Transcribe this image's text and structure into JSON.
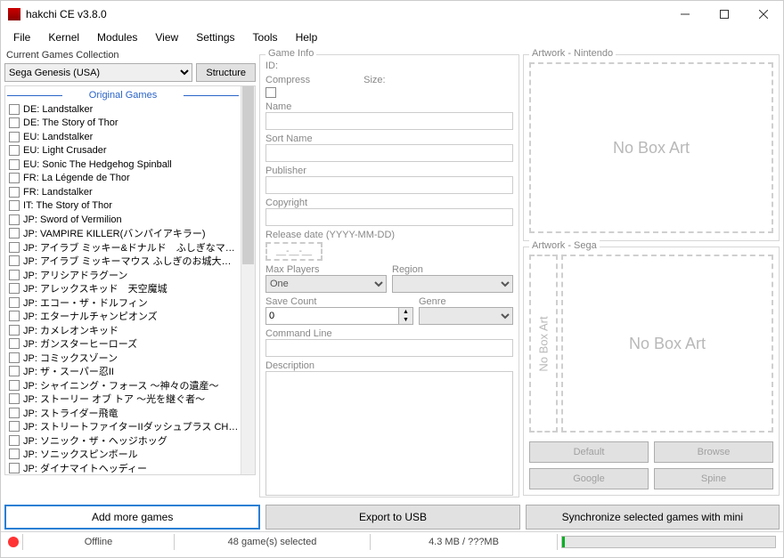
{
  "window": {
    "title": "hakchi CE v3.8.0"
  },
  "menu": [
    "File",
    "Kernel",
    "Modules",
    "View",
    "Settings",
    "Tools",
    "Help"
  ],
  "collection": {
    "label": "Current Games Collection",
    "selected": "Sega Genesis (USA)",
    "structure_btn": "Structure"
  },
  "games": {
    "header": "Original Games",
    "items": [
      "DE: Landstalker",
      "DE: The Story of Thor",
      "EU: Landstalker",
      "EU: Light Crusader",
      "EU: Sonic The Hedgehog Spinball",
      "FR: La Légende de Thor",
      "FR: Landstalker",
      "IT: The Story of Thor",
      "JP: Sword of Vermilion",
      "JP: VAMPIRE KILLER(バンパイアキラー)",
      "JP: アイラブ ミッキー&ドナルド　ふしぎなマジックボッ...",
      "JP: アイラブ ミッキーマウス ふしぎのお城大冒険",
      "JP: アリシアドラグーン",
      "JP: アレックスキッド　天空魔城",
      "JP: エコー・ザ・ドルフィン",
      "JP: エターナルチャンピオンズ",
      "JP: カメレオンキッド",
      "JP: ガンスターヒーローズ",
      "JP: コミックスゾーン",
      "JP: ザ・スーパー忍II",
      "JP: シャイニング・フォース ～神々の遺産～",
      "JP: ストーリー オブ トア ～光を継ぐ者～",
      "JP: ストライダー飛竜",
      "JP: ストリートファイターIIダッシュプラス CHAMPION E...",
      "JP: ソニック・ザ・ヘッジホッグ",
      "JP: ソニックスピンボール",
      "JP: ダイナマイトヘッディー"
    ]
  },
  "info": {
    "group": "Game Info",
    "id_lbl": "ID:",
    "compress_lbl": "Compress",
    "size_lbl": "Size:",
    "name_lbl": "Name",
    "sort_lbl": "Sort Name",
    "publisher_lbl": "Publisher",
    "copyright_lbl": "Copyright",
    "release_lbl": "Release date (YYYY-MM-DD)",
    "release_val": "__-__-__",
    "maxp_lbl": "Max Players",
    "maxp_val": "One",
    "region_lbl": "Region",
    "save_lbl": "Save Count",
    "save_val": "0",
    "genre_lbl": "Genre",
    "cmd_lbl": "Command Line",
    "desc_lbl": "Description"
  },
  "art": {
    "nin_lbl": "Artwork - Nintendo",
    "sega_lbl": "Artwork - Sega",
    "none": "No Box Art",
    "btns": {
      "default": "Default",
      "browse": "Browse",
      "google": "Google",
      "spine": "Spine"
    }
  },
  "bottom": {
    "add": "Add more games",
    "export": "Export to USB",
    "sync": "Synchronize selected games with mini"
  },
  "status": {
    "offline": "Offline",
    "count": "48 game(s) selected",
    "size": "4.3 MB / ???MB"
  }
}
